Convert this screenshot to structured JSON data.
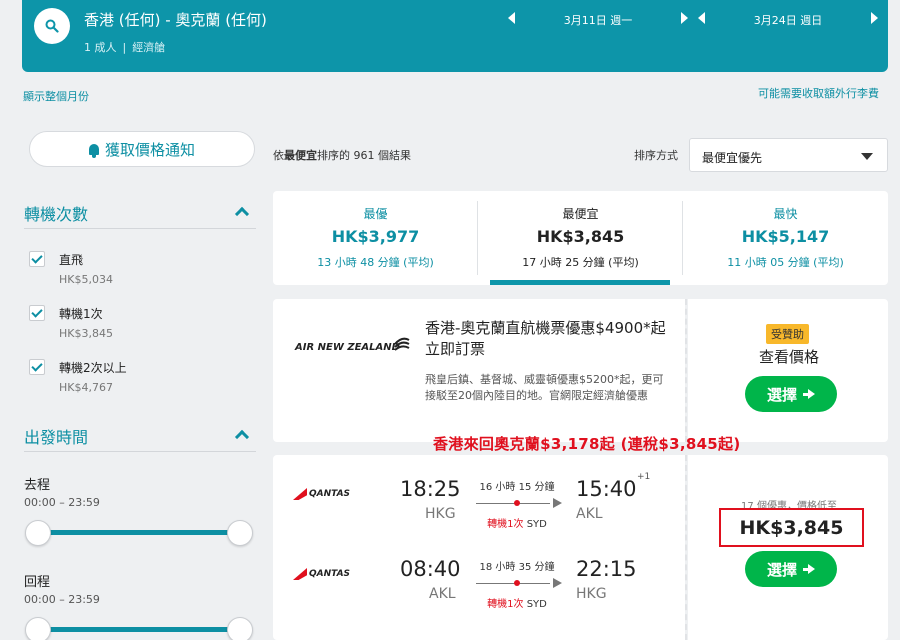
{
  "header": {
    "route": "香港 (任何) - 奧克蘭 (任何)",
    "passengers": "1 成人",
    "cabin": "經濟艙",
    "depart_date": "3月11日 週一",
    "return_date": "3月24日 週日"
  },
  "links": {
    "show_month": "顯示整個月份",
    "extra_fees": "可能需要收取額外行李費"
  },
  "sidebar": {
    "alert_button": "獲取價格通知",
    "stops_title": "轉機次數",
    "stops": [
      {
        "label": "直飛",
        "price": "HK$5,034"
      },
      {
        "label": "轉機1次",
        "price": "HK$3,845"
      },
      {
        "label": "轉機2次以上",
        "price": "HK$4,767"
      }
    ],
    "times_title": "出發時間",
    "outbound_label": "去程",
    "outbound_range": "00:00 – 23:59",
    "return_label": "回程",
    "return_range": "00:00 – 23:59"
  },
  "results": {
    "prefix": "依",
    "sort_word": "最便宜",
    "suffix": "排序的 961 個結果",
    "sort_label": "排序方式",
    "sort_value": "最便宜優先"
  },
  "tabs": [
    {
      "name": "最優",
      "price": "HK$3,977",
      "duration": "13 小時 48 分鐘 (平均)"
    },
    {
      "name": "最便宜",
      "price": "HK$3,845",
      "duration": "17 小時 25 分鐘 (平均)"
    },
    {
      "name": "最快",
      "price": "HK$5,147",
      "duration": "11 小時 05 分鐘 (平均)"
    }
  ],
  "ad": {
    "airline": "AIR NEW ZEALAND",
    "title": "香港-奧克蘭直航機票優惠$4900*起 立即訂票",
    "desc": "飛皇后鎮、基督城、威靈頓優惠$5200*起，更可接駁至20個內陸目的地。官網限定經濟艙優惠",
    "sponsored": "受贊助",
    "price_label": "查看價格",
    "button": "選擇"
  },
  "promo": "香港來回奧克蘭$3,178起 (連稅$3,845起)",
  "flight": {
    "airline": "QANTAS",
    "outbound": {
      "depart_time": "18:25",
      "depart_code": "HKG",
      "duration": "16 小時 15 分鐘",
      "arrive_time": "15:40",
      "arrive_code": "AKL",
      "plus_day": "+1",
      "stops": "轉機1次",
      "via": "SYD"
    },
    "inbound": {
      "depart_time": "08:40",
      "depart_code": "AKL",
      "duration": "18 小時 35 分鐘",
      "arrive_time": "22:15",
      "arrive_code": "HKG",
      "stops": "轉機1次",
      "via": "SYD"
    },
    "deal_note": "17 個優惠，價格低至",
    "price": "HK$3,845",
    "button": "選擇"
  },
  "colors": {
    "teal": "#0d95a9",
    "green": "#00b54a",
    "red": "#e0101e",
    "sponsor": "#f8b82b"
  }
}
